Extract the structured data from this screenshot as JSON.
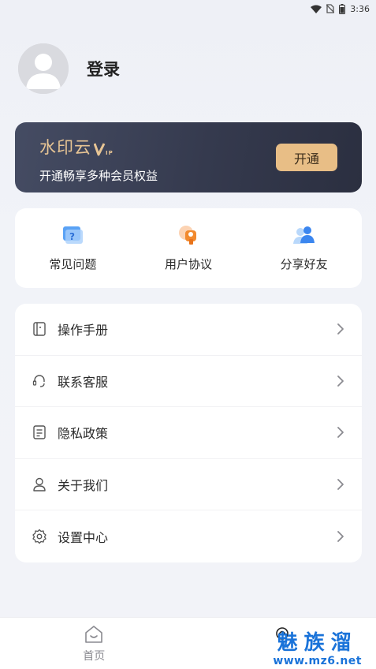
{
  "status_bar": {
    "time": "3:36"
  },
  "profile": {
    "login_label": "登录"
  },
  "vip_card": {
    "brand": "水印云",
    "badge": "VIP",
    "subtitle": "开通畅享多种会员权益",
    "button_label": "开通"
  },
  "quick_actions": [
    {
      "label": "常见问题",
      "icon": "faq-icon"
    },
    {
      "label": "用户协议",
      "icon": "agreement-icon"
    },
    {
      "label": "分享好友",
      "icon": "share-friends-icon"
    }
  ],
  "menu": [
    {
      "label": "操作手册",
      "icon": "manual-icon"
    },
    {
      "label": "联系客服",
      "icon": "headset-icon"
    },
    {
      "label": "隐私政策",
      "icon": "document-icon"
    },
    {
      "label": "关于我们",
      "icon": "user-icon"
    },
    {
      "label": "设置中心",
      "icon": "gear-icon"
    }
  ],
  "tabbar": {
    "home_label": "首页"
  },
  "watermark": {
    "title": "魅族溜",
    "url": "www.mz6.net"
  },
  "colors": {
    "accent_gold": "#e8be86",
    "vip_bg": "#353a4e",
    "link_blue": "#1a73d9"
  }
}
